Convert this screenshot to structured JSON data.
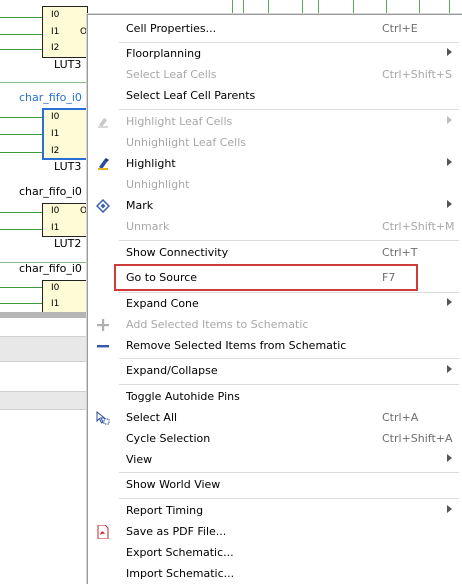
{
  "schematic": {
    "instances": [
      {
        "name": "",
        "pins": [
          "I0",
          "I1",
          "I2"
        ],
        "out_pin": "O",
        "type_label": "LUT3",
        "selected": false
      },
      {
        "name": "char_fifo_i0",
        "pins": [
          "I0",
          "I1",
          "I2"
        ],
        "out_pin": "",
        "type_label": "LUT3",
        "selected": true
      },
      {
        "name": "char_fifo_i0",
        "pins": [
          "I0",
          "I1"
        ],
        "out_pin": "O",
        "type_label": "LUT2",
        "selected": false
      },
      {
        "name": "char_fifo_i0",
        "pins": [
          "I0",
          "I1"
        ],
        "out_pin": "",
        "type_label": "",
        "selected": false
      }
    ],
    "colors": {
      "wire": "#3c9a3c",
      "lut_fill": "#fffbd6",
      "selected": "#2a6fd6"
    }
  },
  "context_menu": {
    "items": [
      {
        "label": "Cell Properties...",
        "shortcut": "Ctrl+E",
        "submenu": false,
        "enabled": true,
        "icon": ""
      },
      {
        "label": "Floorplanning",
        "shortcut": "",
        "submenu": true,
        "enabled": true,
        "icon": ""
      },
      {
        "label": "Select Leaf Cells",
        "shortcut": "Ctrl+Shift+S",
        "submenu": false,
        "enabled": false,
        "icon": ""
      },
      {
        "label": "Select Leaf Cell Parents",
        "shortcut": "",
        "submenu": false,
        "enabled": true,
        "icon": ""
      },
      {
        "label": "Highlight Leaf Cells",
        "shortcut": "",
        "submenu": true,
        "enabled": false,
        "icon": "highlighter-icon"
      },
      {
        "label": "Unhighlight Leaf Cells",
        "shortcut": "",
        "submenu": false,
        "enabled": false,
        "icon": ""
      },
      {
        "label": "Highlight",
        "shortcut": "",
        "submenu": true,
        "enabled": true,
        "icon": "highlighter-icon"
      },
      {
        "label": "Unhighlight",
        "shortcut": "",
        "submenu": false,
        "enabled": false,
        "icon": ""
      },
      {
        "label": "Mark",
        "shortcut": "",
        "submenu": true,
        "enabled": true,
        "icon": "mark-diamond-icon"
      },
      {
        "label": "Unmark",
        "shortcut": "Ctrl+Shift+M",
        "submenu": false,
        "enabled": false,
        "icon": ""
      },
      {
        "label": "Show Connectivity",
        "shortcut": "Ctrl+T",
        "submenu": false,
        "enabled": true,
        "icon": ""
      },
      {
        "label": "Go to Source",
        "shortcut": "F7",
        "submenu": false,
        "enabled": true,
        "icon": ""
      },
      {
        "label": "Expand Cone",
        "shortcut": "",
        "submenu": true,
        "enabled": true,
        "icon": ""
      },
      {
        "label": "Add Selected Items to Schematic",
        "shortcut": "",
        "submenu": false,
        "enabled": false,
        "icon": "plus-icon"
      },
      {
        "label": "Remove Selected Items from Schematic",
        "shortcut": "",
        "submenu": false,
        "enabled": true,
        "icon": "minus-icon"
      },
      {
        "label": "Expand/Collapse",
        "shortcut": "",
        "submenu": true,
        "enabled": true,
        "icon": ""
      },
      {
        "label": "Toggle Autohide Pins",
        "shortcut": "",
        "submenu": false,
        "enabled": true,
        "icon": ""
      },
      {
        "label": "Select All",
        "shortcut": "Ctrl+A",
        "submenu": false,
        "enabled": true,
        "icon": "select-all-icon"
      },
      {
        "label": "Cycle Selection",
        "shortcut": "Ctrl+Shift+A",
        "submenu": false,
        "enabled": true,
        "icon": ""
      },
      {
        "label": "View",
        "shortcut": "",
        "submenu": true,
        "enabled": true,
        "icon": ""
      },
      {
        "label": "Show World View",
        "shortcut": "",
        "submenu": false,
        "enabled": true,
        "icon": ""
      },
      {
        "label": "Report Timing",
        "shortcut": "",
        "submenu": true,
        "enabled": true,
        "icon": ""
      },
      {
        "label": "Save as PDF File...",
        "shortcut": "",
        "submenu": false,
        "enabled": true,
        "icon": "pdf-icon"
      },
      {
        "label": "Export Schematic...",
        "shortcut": "",
        "submenu": false,
        "enabled": true,
        "icon": ""
      },
      {
        "label": "Import Schematic...",
        "shortcut": "",
        "submenu": false,
        "enabled": true,
        "icon": ""
      }
    ],
    "highlighted_item": "Go to Source",
    "highlight_color": "#cf3b3b"
  }
}
